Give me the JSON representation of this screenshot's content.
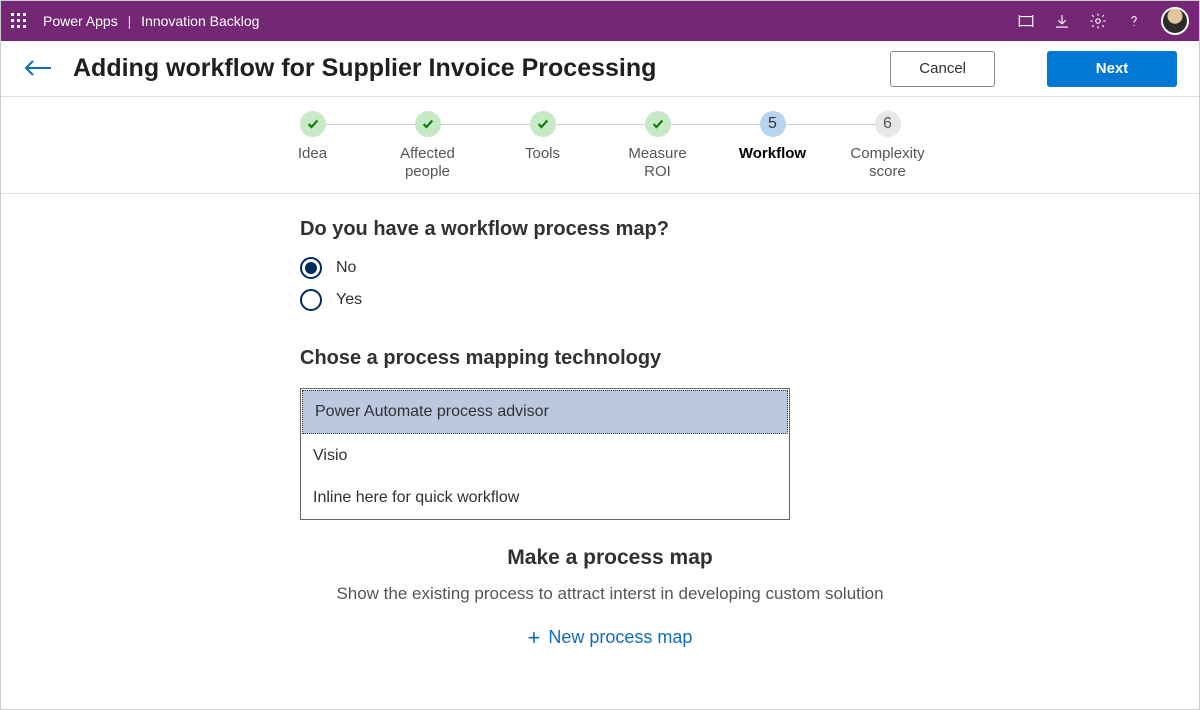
{
  "topbar": {
    "app": "Power Apps",
    "divider": "|",
    "section": "Innovation Backlog"
  },
  "header": {
    "title": "Adding workflow for Supplier Invoice Processing",
    "cancel": "Cancel",
    "next": "Next"
  },
  "stepper": {
    "steps": [
      {
        "label": "Idea",
        "state": "done"
      },
      {
        "label": "Affected people",
        "state": "done"
      },
      {
        "label": "Tools",
        "state": "done"
      },
      {
        "label": "Measure ROI",
        "state": "done"
      },
      {
        "label": "Workflow",
        "state": "current",
        "num": "5"
      },
      {
        "label": "Complexity score",
        "state": "future",
        "num": "6"
      }
    ]
  },
  "q_workflow_map": {
    "question": "Do you have a workflow process map?",
    "options": [
      "No",
      "Yes"
    ],
    "selected": "No"
  },
  "q_technology": {
    "question": "Chose a process mapping technology",
    "options": [
      "Power Automate process advisor",
      "Visio",
      "Inline here for quick workflow"
    ],
    "selected_index": 0
  },
  "make_map": {
    "title": "Make a process map",
    "subtitle": "Show the existing process to attract interst in developing custom solution",
    "add_label": "New process map"
  }
}
